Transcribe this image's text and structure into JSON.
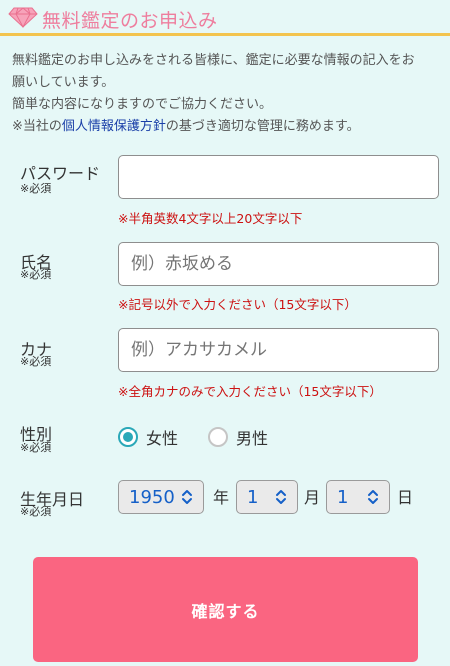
{
  "header": {
    "title": "無料鑑定のお申込み",
    "icon": "diamond-icon",
    "accent_color": "#ee7e9e",
    "underline_color": "#f3c44e"
  },
  "intro": {
    "line1": "無料鑑定のお申し込みをされる皆様に、鑑定に必要な情報の記入をお",
    "line2": "願いしています。",
    "line3": "簡単な内容になりますのでご協力ください。",
    "line4_prefix": "※当社の",
    "line4_link": "個人情報保護方針",
    "line4_suffix": "の基づき適切な管理に務めます。"
  },
  "form": {
    "required_mark": "※必須",
    "password": {
      "label": "パスワード",
      "value": "",
      "hint": "※半角英数4文字以上20文字以下"
    },
    "name": {
      "label": "氏名",
      "placeholder": "例）赤坂める",
      "hint": "※記号以外で入力ください（15文字以下）"
    },
    "kana": {
      "label": "カナ",
      "placeholder": "例）アカサカメル",
      "hint": "※全角カナのみで入力ください（15文字以下）"
    },
    "gender": {
      "label": "性別",
      "options": [
        "女性",
        "男性"
      ],
      "selected": "女性"
    },
    "birthdate": {
      "label": "生年月日",
      "year": "1950",
      "year_unit": "年",
      "month": "1",
      "month_unit": "月",
      "day": "1",
      "day_unit": "日"
    },
    "submit_label": "確認する"
  },
  "colors": {
    "background": "#e6f8f7",
    "error": "#cc1111",
    "radio_checked": "#2aa8b8",
    "select_value": "#1560c8",
    "submit_button": "#fa6581",
    "link": "#1a3fa8"
  }
}
